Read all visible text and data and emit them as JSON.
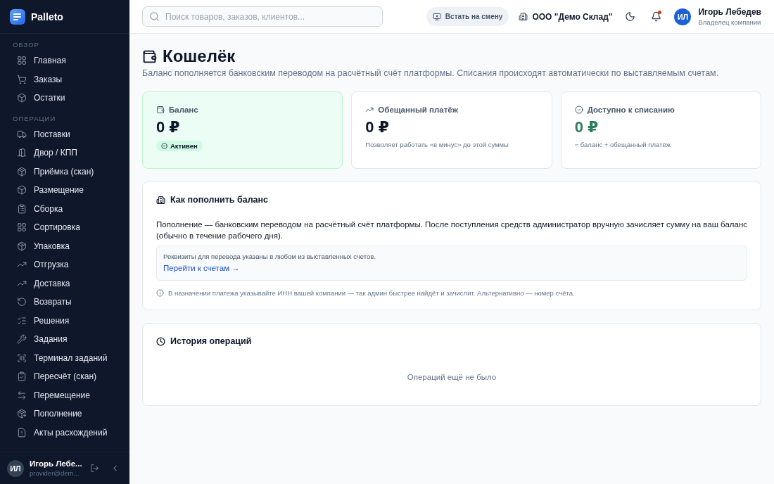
{
  "sidebar": {
    "brand": "Palleto",
    "sections": [
      {
        "title": "ОБЗОР",
        "items": [
          {
            "label": "Главная"
          },
          {
            "label": "Заказы"
          },
          {
            "label": "Остатки"
          }
        ]
      },
      {
        "title": "ОПЕРАЦИИ",
        "items": [
          {
            "label": "Поставки"
          },
          {
            "label": "Двор / КПП"
          },
          {
            "label": "Приёмка (скан)"
          },
          {
            "label": "Размещение"
          },
          {
            "label": "Сборка"
          },
          {
            "label": "Сортировка"
          },
          {
            "label": "Упаковка"
          },
          {
            "label": "Отгрузка"
          },
          {
            "label": "Доставка"
          },
          {
            "label": "Возвраты"
          },
          {
            "label": "Решения"
          },
          {
            "label": "Задания"
          },
          {
            "label": "Терминал заданий"
          },
          {
            "label": "Пересчёт (скан)"
          },
          {
            "label": "Перемещение"
          },
          {
            "label": "Пополнение"
          },
          {
            "label": "Акты расхождений"
          }
        ]
      }
    ],
    "user": {
      "initials": "ИЛ",
      "name": "Игорь Лебе...",
      "email": "provider@dem..."
    }
  },
  "header": {
    "search": {
      "placeholder": "Поиск товаров, заказов, клиентов..."
    },
    "shift_button": "Встать на смену",
    "company": "ООО \"Демо Склад\"",
    "notifications_unread": true,
    "user": {
      "initials": "ИЛ",
      "name": "Игорь Лебедев",
      "role": "Владелец компании"
    }
  },
  "page": {
    "title": "Кошелёк",
    "subtitle": "Баланс пополняется банковским переводом на расчётный счёт платформы. Списания происходят автоматически по выставляемым счетам.",
    "cards": [
      {
        "kind": "balance",
        "label": "Баланс",
        "amount": "0 ₽",
        "badge": "Активен"
      },
      {
        "kind": "promised",
        "label": "Обещанный платёж",
        "amount": "0 ₽",
        "note": "Позволяет работать «в минус» до этой суммы"
      },
      {
        "kind": "available",
        "label": "Доступно к списанию",
        "amount": "0 ₽",
        "note": "= баланс + обещанный платёж"
      }
    ],
    "topup": {
      "title": "Как пополнить баланс",
      "text": "Пополнение — банковским переводом на расчётный счёт платформы. После поступления средств администратор вручную зачисляет сумму на ваш баланс (обычно в течение рабочего дня).",
      "requisites": "Реквизиты для перевода указаны в любом из выставленных счетов.",
      "link": "Перейти к счетам →",
      "hint": "В назначении платежа указывайте ИНН вашей компании — так админ быстрее найдёт и зачислит. Альтернативно — номер счёта."
    },
    "history": {
      "title": "История операций",
      "empty": "Операций ещё не было"
    }
  }
}
